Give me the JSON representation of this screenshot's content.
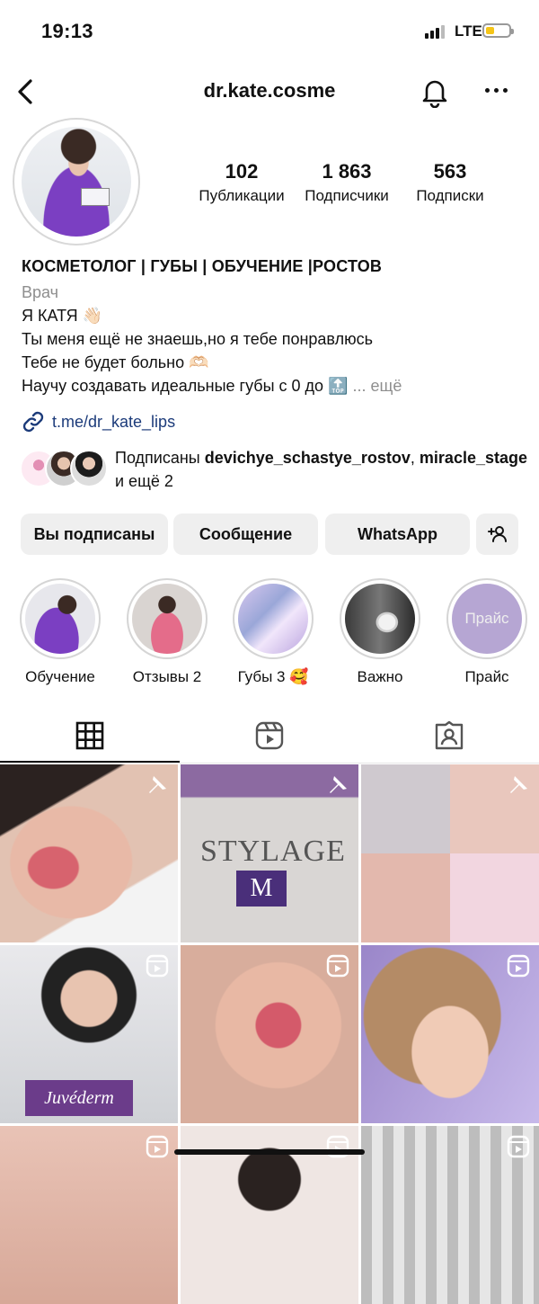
{
  "status": {
    "time": "19:13",
    "network": "LTE"
  },
  "header": {
    "username": "dr.kate.cosme"
  },
  "stats": [
    {
      "value": "102",
      "label": "Публикации"
    },
    {
      "value": "1 863",
      "label": "Подписчики"
    },
    {
      "value": "563",
      "label": "Подписки"
    }
  ],
  "bio": {
    "name": "КОСМЕТОЛОГ | ГУБЫ | ОБУЧЕНИЕ |РОСТОВ",
    "category": "Врач",
    "line1": "Я КАТЯ 👋🏻",
    "line2": "Ты меня ещё не знаешь,но я тебе понравлюсь",
    "line3": "Тебе не будет больно 🫶🏻",
    "line4": "Научу создавать идеальные губы с 0 до 🔝",
    "more": "... ещё",
    "link": "t.me/dr_kate_lips"
  },
  "followed_by": {
    "prefix": "Подписаны ",
    "user1": "devichye_schastye_rostov",
    "sep": ",",
    "user2": "miracle_stage",
    "suffix": " и ещё 2"
  },
  "buttons": {
    "following": "Вы подписаны",
    "message": "Сообщение",
    "whatsapp": "WhatsApp"
  },
  "highlights": [
    {
      "label": "Обучение"
    },
    {
      "label": "Отзывы 2"
    },
    {
      "label": "Губы 3 🥰"
    },
    {
      "label": "Важно"
    },
    {
      "label": "Прайс",
      "cover_text": "Прайс"
    }
  ],
  "posts": [
    {
      "type": "pinned"
    },
    {
      "type": "pinned",
      "overlay_brand": "STYLAGE",
      "overlay_letter": "M"
    },
    {
      "type": "pinned"
    },
    {
      "type": "reel",
      "overlay_brand": "Juvéderm"
    },
    {
      "type": "reel"
    },
    {
      "type": "reel"
    },
    {
      "type": "reel"
    },
    {
      "type": "reel"
    },
    {
      "type": "reel"
    }
  ],
  "colors": {
    "link": "#1c3b7a",
    "button_bg": "#efefef",
    "accent_purple": "#7b3fc2"
  }
}
